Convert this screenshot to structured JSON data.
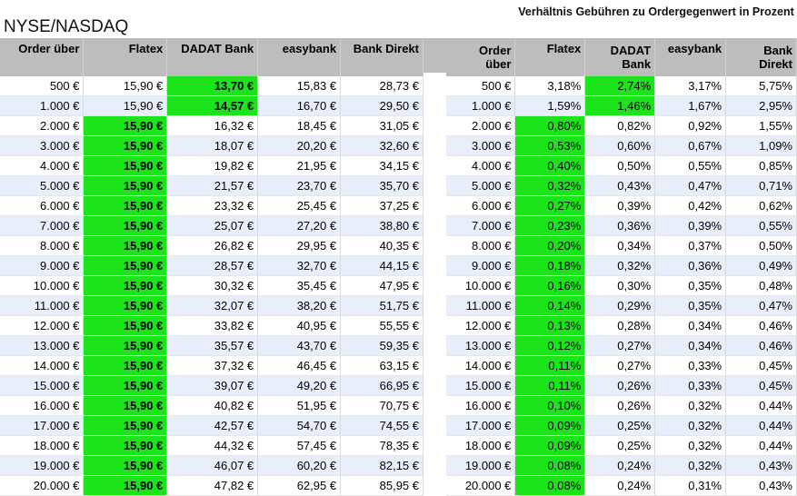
{
  "left_title": "NYSE/NASDAQ",
  "right_title": "Verhältnis Gebühren zu Ordergegenwert in Prozent",
  "colors": {
    "header_bg": "#bdbdbd",
    "highlight": "#1be41b",
    "band": "#e8eefa"
  },
  "left_headers": [
    "Order über",
    "Flatex",
    "DADAT Bank",
    "easybank",
    "Bank Direkt"
  ],
  "right_headers": [
    "Order über",
    "Flatex",
    "DADAT Bank",
    "easybank",
    "Bank Direkt"
  ],
  "left_rows": [
    [
      "500 €",
      "15,90 €",
      "13,70 €",
      "15,83 €",
      "28,73 €"
    ],
    [
      "1.000 €",
      "15,90 €",
      "14,57 €",
      "16,70 €",
      "29,50 €"
    ],
    [
      "2.000 €",
      "15,90 €",
      "16,32 €",
      "18,45 €",
      "31,05 €"
    ],
    [
      "3.000 €",
      "15,90 €",
      "18,07 €",
      "20,20 €",
      "32,60 €"
    ],
    [
      "4.000 €",
      "15,90 €",
      "19,82 €",
      "21,95 €",
      "34,15 €"
    ],
    [
      "5.000 €",
      "15,90 €",
      "21,57 €",
      "23,70 €",
      "35,70 €"
    ],
    [
      "6.000 €",
      "15,90 €",
      "23,32 €",
      "25,45 €",
      "37,25 €"
    ],
    [
      "7.000 €",
      "15,90 €",
      "25,07 €",
      "27,20 €",
      "38,80 €"
    ],
    [
      "8.000 €",
      "15,90 €",
      "26,82 €",
      "29,95 €",
      "40,35 €"
    ],
    [
      "9.000 €",
      "15,90 €",
      "28,57 €",
      "32,70 €",
      "44,15 €"
    ],
    [
      "10.000 €",
      "15,90 €",
      "30,32 €",
      "35,45 €",
      "47,95 €"
    ],
    [
      "11.000 €",
      "15,90 €",
      "32,07 €",
      "38,20 €",
      "51,75 €"
    ],
    [
      "12.000 €",
      "15,90 €",
      "33,82 €",
      "40,95 €",
      "55,55 €"
    ],
    [
      "13.000 €",
      "15,90 €",
      "35,57 €",
      "43,70 €",
      "59,35 €"
    ],
    [
      "14.000 €",
      "15,90 €",
      "37,32 €",
      "46,45 €",
      "63,15 €"
    ],
    [
      "15.000 €",
      "15,90 €",
      "39,07 €",
      "49,20 €",
      "66,95 €"
    ],
    [
      "16.000 €",
      "15,90 €",
      "40,82 €",
      "51,95 €",
      "70,75 €"
    ],
    [
      "17.000 €",
      "15,90 €",
      "42,57 €",
      "54,70 €",
      "74,55 €"
    ],
    [
      "18.000 €",
      "15,90 €",
      "44,32 €",
      "57,45 €",
      "78,35 €"
    ],
    [
      "19.000 €",
      "15,90 €",
      "46,07 €",
      "60,20 €",
      "82,15 €"
    ],
    [
      "20.000 €",
      "15,90 €",
      "47,82 €",
      "62,95 €",
      "85,95 €"
    ]
  ],
  "right_rows": [
    [
      "500 €",
      "3,18%",
      "2,74%",
      "3,17%",
      "5,75%"
    ],
    [
      "1.000 €",
      "1,59%",
      "1,46%",
      "1,67%",
      "2,95%"
    ],
    [
      "2.000 €",
      "0,80%",
      "0,82%",
      "0,92%",
      "1,55%"
    ],
    [
      "3.000 €",
      "0,53%",
      "0,60%",
      "0,67%",
      "1,09%"
    ],
    [
      "4.000 €",
      "0,40%",
      "0,50%",
      "0,55%",
      "0,85%"
    ],
    [
      "5.000 €",
      "0,32%",
      "0,43%",
      "0,47%",
      "0,71%"
    ],
    [
      "6.000 €",
      "0,27%",
      "0,39%",
      "0,42%",
      "0,62%"
    ],
    [
      "7.000 €",
      "0,23%",
      "0,36%",
      "0,39%",
      "0,55%"
    ],
    [
      "8.000 €",
      "0,20%",
      "0,34%",
      "0,37%",
      "0,50%"
    ],
    [
      "9.000 €",
      "0,18%",
      "0,32%",
      "0,36%",
      "0,49%"
    ],
    [
      "10.000 €",
      "0,16%",
      "0,30%",
      "0,35%",
      "0,48%"
    ],
    [
      "11.000 €",
      "0,14%",
      "0,29%",
      "0,35%",
      "0,47%"
    ],
    [
      "12.000 €",
      "0,13%",
      "0,28%",
      "0,34%",
      "0,46%"
    ],
    [
      "13.000 €",
      "0,12%",
      "0,27%",
      "0,34%",
      "0,46%"
    ],
    [
      "14.000 €",
      "0,11%",
      "0,27%",
      "0,33%",
      "0,45%"
    ],
    [
      "15.000 €",
      "0,11%",
      "0,26%",
      "0,33%",
      "0,45%"
    ],
    [
      "16.000 €",
      "0,10%",
      "0,26%",
      "0,32%",
      "0,44%"
    ],
    [
      "17.000 €",
      "0,09%",
      "0,25%",
      "0,32%",
      "0,44%"
    ],
    [
      "18.000 €",
      "0,09%",
      "0,25%",
      "0,32%",
      "0,44%"
    ],
    [
      "19.000 €",
      "0,08%",
      "0,24%",
      "0,32%",
      "0,43%"
    ],
    [
      "20.000 €",
      "0,08%",
      "0,24%",
      "0,31%",
      "0,43%"
    ]
  ],
  "highlight_column_by_row": [
    2,
    2,
    1,
    1,
    1,
    1,
    1,
    1,
    1,
    1,
    1,
    1,
    1,
    1,
    1,
    1,
    1,
    1,
    1,
    1,
    1
  ]
}
